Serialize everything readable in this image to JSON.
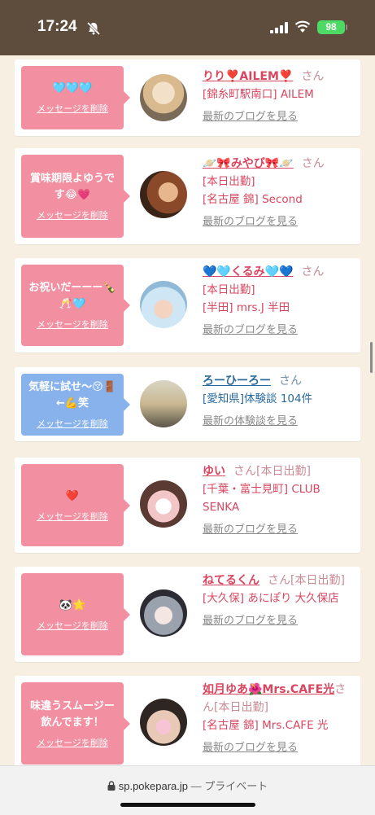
{
  "status": {
    "time": "17:24",
    "battery": "98"
  },
  "browser": {
    "url": "sp.pokepara.jp",
    "mode": "— プライベート"
  },
  "messages": [
    {
      "bubble_text": "🩵🩵🩵",
      "delete_label": "メッセージを削除",
      "name": "りり❣️AILEM❣️",
      "san": "さん",
      "lines": [
        "[錦糸町駅南口] AILEM"
      ],
      "link_label": "最新のブログを見る",
      "color": "#f28fa1"
    },
    {
      "bubble_text": "賞味期限よゆうです😂💗",
      "delete_label": "メッセージを削除",
      "name": "🪐🎀みやび🎀🪐",
      "san": "さん",
      "lines": [
        "[本日出勤]",
        "[名古屋 錦] Second"
      ],
      "link_label": "最新のブログを見る",
      "color": "#f28fa1"
    },
    {
      "bubble_text": "お祝いだーーー🍾🥂🩵",
      "delete_label": "メッセージを削除",
      "name": "💙🩵くるみ🩵💙",
      "san": "さん",
      "lines": [
        "[本日出勤]",
        "[半田] mrs.J 半田"
      ],
      "link_label": "最新のブログを見る",
      "color": "#f28fa1"
    },
    {
      "bubble_text": "気軽に試せ〜😚🚪←💪笑",
      "delete_label": "メッセージを削除",
      "name": "ろーひーろー",
      "san": "さん",
      "lines": [
        "[愛知県]体験談 104件"
      ],
      "link_label": "最新の体験談を見る",
      "color": "#87b2ec"
    },
    {
      "bubble_text": "❤️",
      "delete_label": "メッセージを削除",
      "name": "ゆい",
      "san": "さん[本日出勤]",
      "lines": [
        "[千葉・富士見町] CLUB SENKA"
      ],
      "link_label": "最新のブログを見る",
      "color": "#f28fa1"
    },
    {
      "bubble_text": "🐼🌟",
      "delete_label": "メッセージを削除",
      "name": "ねてるくん",
      "san": "さん[本日出勤]",
      "lines": [
        "[大久保] あにぽり 大久保店"
      ],
      "link_label": "最新のブログを見る",
      "color": "#f28fa1"
    },
    {
      "bubble_text": "味違うスムージー飲んでます！",
      "delete_label": "メッセージを削除",
      "name": "如月ゆあ🌺Mrs.CAFE光",
      "san": "さん[本日出勤]",
      "lines": [
        "[名古屋 錦] Mrs.CAFE 光"
      ],
      "link_label": "最新のブログを見る",
      "color": "#f28fa1"
    }
  ]
}
